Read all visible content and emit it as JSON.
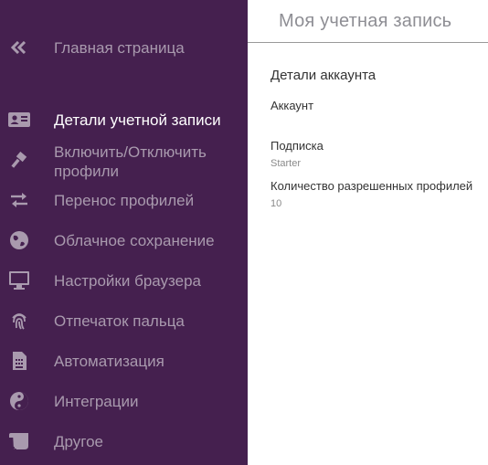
{
  "sidebar": {
    "colors": {
      "background": "#45204f",
      "text": "#a99aae",
      "active_text": "#ffffff"
    },
    "items": [
      {
        "label": "Главная страница",
        "icon": "double-chevron-left-icon"
      },
      {
        "label": "Детали учетной записи",
        "icon": "id-card-icon",
        "active": true
      },
      {
        "label": "Включить/Отключить профили",
        "icon": "gavel-icon"
      },
      {
        "label": "Перенос профилей",
        "icon": "swap-arrows-icon"
      },
      {
        "label": "Облачное сохранение",
        "icon": "globe-icon"
      },
      {
        "label": "Настройки браузера",
        "icon": "monitor-icon"
      },
      {
        "label": "Отпечаток пальца",
        "icon": "fingerprint-icon"
      },
      {
        "label": "Автоматизация",
        "icon": "sim-card-icon"
      },
      {
        "label": "Интеграции",
        "icon": "yin-yang-icon"
      },
      {
        "label": "Другое",
        "icon": "scroll-icon"
      }
    ]
  },
  "main": {
    "title": "Моя учетная запись",
    "section_title": "Детали аккаунта",
    "fields": {
      "account_label": "Аккаунт",
      "account_value": "",
      "subscription_label": "Подписка",
      "subscription_value": "Starter",
      "profiles_label": "Количество разрешенных профилей",
      "profiles_value": "10"
    }
  }
}
